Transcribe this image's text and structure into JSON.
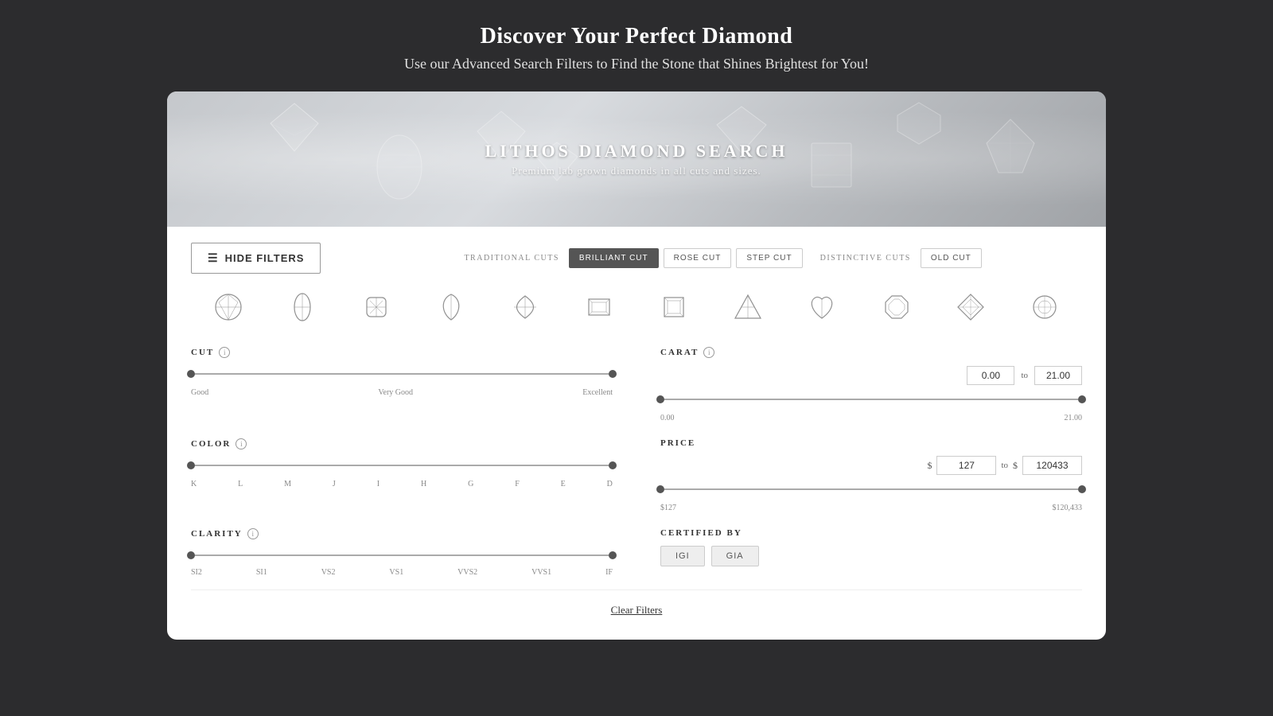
{
  "page": {
    "heading": "Discover Your Perfect Diamond",
    "subheading": "Use our Advanced Search Filters to Find the Stone that Shines Brightest for You!"
  },
  "banner": {
    "title": "LITHOS DIAMOND SEARCH",
    "subtitle": "Premium lab grown diamonds in all cuts and sizes."
  },
  "filters": {
    "hide_filters_label": "HIDE FILTERS",
    "traditional_cuts_label": "TRADITIONAL CUTS",
    "distinctive_cuts_label": "DISTINCTIVE CUTS",
    "cut_buttons": [
      {
        "label": "BRILLIANT CUT",
        "active": true
      },
      {
        "label": "ROSE CUT",
        "active": false
      },
      {
        "label": "STEP CUT",
        "active": false
      },
      {
        "label": "OLD CUT",
        "active": false
      }
    ],
    "cut": {
      "label": "CUT",
      "min_label": "Good",
      "mid_label": "Very Good",
      "max_label": "Excellent",
      "thumb_left_pct": 0,
      "thumb_right_pct": 100
    },
    "carat": {
      "label": "CARAT",
      "min_value": "0.00",
      "max_value": "21.00",
      "input_min": "0.00",
      "input_max": "21.00",
      "thumb_left_pct": 0,
      "thumb_right_pct": 100
    },
    "color": {
      "label": "COLOR",
      "labels": [
        "K",
        "L",
        "M",
        "J",
        "I",
        "H",
        "G",
        "F",
        "E",
        "D"
      ],
      "thumb_left_pct": 0,
      "thumb_right_pct": 100
    },
    "price": {
      "label": "PRICE",
      "min_value": "$127",
      "max_value": "$120,433",
      "input_min": "127",
      "input_max": "120433",
      "thumb_left_pct": 0,
      "thumb_right_pct": 100
    },
    "clarity": {
      "label": "CLARITY",
      "labels": [
        "SI2",
        "SI1",
        "VS2",
        "VS1",
        "VVS2",
        "VVS1",
        "IF"
      ],
      "thumb_left_pct": 0,
      "thumb_right_pct": 100
    },
    "certified_by": {
      "label": "CERTIFIED BY",
      "buttons": [
        {
          "label": "IGI",
          "active": false
        },
        {
          "label": "GIA",
          "active": false
        }
      ]
    },
    "clear_filters": "Clear Filters"
  }
}
